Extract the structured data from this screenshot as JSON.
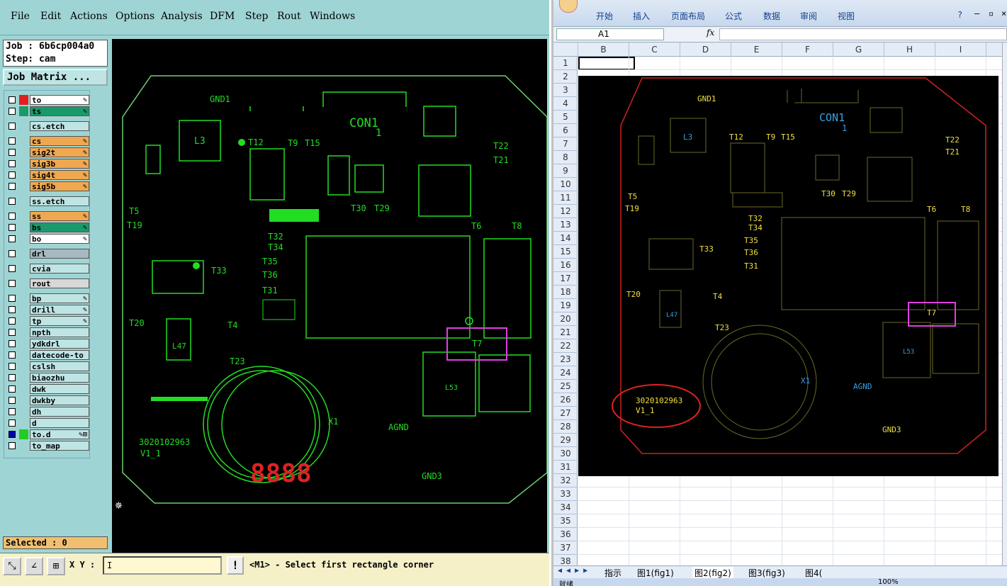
{
  "cam": {
    "menu": [
      "File",
      "Edit",
      "Actions",
      "Options",
      "Analysis",
      "DFM",
      "Step",
      "Rout",
      "Windows"
    ],
    "job_line": "Job : 6b6cp004a0",
    "step_line": "Step: cam",
    "job_matrix": "Job Matrix ...",
    "layers": [
      {
        "name": "to",
        "color": "#e02020",
        "bg": "#ffffff",
        "mark": "✎"
      },
      {
        "name": "ts",
        "color": "#1a9a6a",
        "bg": "#1a9a6a",
        "mark": "✎"
      },
      {
        "name": "cs.etch",
        "color": "",
        "bg": "#bfe4e4",
        "mark": ""
      },
      {
        "name": "cs",
        "color": "",
        "bg": "#f0a850",
        "mark": "✎"
      },
      {
        "name": "sig2t",
        "color": "",
        "bg": "#f0a850",
        "mark": "✎"
      },
      {
        "name": "sig3b",
        "color": "",
        "bg": "#f0a850",
        "mark": "✎"
      },
      {
        "name": "sig4t",
        "color": "",
        "bg": "#f0a850",
        "mark": "✎"
      },
      {
        "name": "sig5b",
        "color": "",
        "bg": "#f0a850",
        "mark": "✎"
      },
      {
        "name": "ss.etch",
        "color": "",
        "bg": "#bfe4e4",
        "mark": ""
      },
      {
        "name": "ss",
        "color": "",
        "bg": "#f0a850",
        "mark": "✎"
      },
      {
        "name": "bs",
        "color": "",
        "bg": "#1a9a6a",
        "mark": "✎"
      },
      {
        "name": "bo",
        "color": "",
        "bg": "#ffffff",
        "mark": "✎"
      },
      {
        "name": "drl",
        "color": "",
        "bg": "#a8b8c0",
        "mark": ""
      },
      {
        "name": "cvia",
        "color": "",
        "bg": "#bfe4e4",
        "mark": ""
      },
      {
        "name": "rout",
        "color": "",
        "bg": "#d8d8d8",
        "mark": ""
      },
      {
        "name": "bp",
        "color": "",
        "bg": "#bfe4e4",
        "mark": "✎"
      },
      {
        "name": "drill",
        "color": "",
        "bg": "#bfe4e4",
        "mark": "✎"
      },
      {
        "name": "tp",
        "color": "",
        "bg": "#bfe4e4",
        "mark": "✎"
      },
      {
        "name": "npth",
        "color": "",
        "bg": "#bfe4e4",
        "mark": ""
      },
      {
        "name": "ydkdrl",
        "color": "",
        "bg": "#bfe4e4",
        "mark": ""
      },
      {
        "name": "datecode-to",
        "color": "",
        "bg": "#bfe4e4",
        "mark": ""
      },
      {
        "name": "cslsh",
        "color": "",
        "bg": "#bfe4e4",
        "mark": ""
      },
      {
        "name": "biaozhu",
        "color": "",
        "bg": "#bfe4e4",
        "mark": ""
      },
      {
        "name": "dwk",
        "color": "",
        "bg": "#bfe4e4",
        "mark": ""
      },
      {
        "name": "dwkby",
        "color": "",
        "bg": "#bfe4e4",
        "mark": ""
      },
      {
        "name": "dh",
        "color": "",
        "bg": "#bfe4e4",
        "mark": ""
      },
      {
        "name": "d",
        "color": "",
        "bg": "#bfe4e4",
        "mark": ""
      },
      {
        "name": "to.d",
        "color": "#22cc22",
        "bg": "#bfe4e4",
        "mark": "✎⊞"
      },
      {
        "name": "to_map",
        "color": "",
        "bg": "#bfe4e4",
        "mark": ""
      }
    ],
    "selected": "Selected : 0",
    "xy_label": "X Y :",
    "xy_value": "I",
    "bang": "!",
    "prompt": "<M1> - Select first rectangle corner",
    "pcb_labels": [
      "GND1",
      "CON1",
      "1",
      "L3",
      "T12",
      "T9",
      "T15",
      "T22",
      "T21",
      "T5",
      "T19",
      "T30",
      "T29",
      "T6",
      "T8",
      "T32",
      "T34",
      "T35",
      "T36",
      "T31",
      "T33",
      "T20",
      "T4",
      "L47",
      "T7",
      "T23",
      "X1",
      "AGND",
      "L53",
      "GND3",
      "3020102963",
      "V1_1",
      "8888"
    ]
  },
  "excel": {
    "tabs": [
      "开始",
      "插入",
      "页面布局",
      "公式",
      "数据",
      "审阅",
      "视图"
    ],
    "name_box": "A1",
    "fx": "fx",
    "columns": [
      "B",
      "C",
      "D",
      "E",
      "F",
      "G",
      "H",
      "I"
    ],
    "rows": [
      "1",
      "2",
      "3",
      "4",
      "5",
      "6",
      "7",
      "8",
      "9",
      "10",
      "11",
      "12",
      "13",
      "14",
      "15",
      "16",
      "17",
      "18",
      "19",
      "20",
      "21",
      "22",
      "23",
      "24",
      "25",
      "26",
      "27",
      "28",
      "29",
      "30",
      "31",
      "32",
      "33",
      "34",
      "35",
      "36",
      "37",
      "38"
    ],
    "sheets": [
      "指示",
      "图1(fig1)",
      "图2(fig2)",
      "图3(fig3)",
      "图4("
    ],
    "status": "就绪",
    "zoom": "100%",
    "pcb_labels": [
      "GND1",
      "CON1",
      "1",
      "L3",
      "T12",
      "T9",
      "T15",
      "T22",
      "T21",
      "T5",
      "T19",
      "T30",
      "T29",
      "T6",
      "T8",
      "T32",
      "T34",
      "T35",
      "T36",
      "T31",
      "T33",
      "T20",
      "T4",
      "L47",
      "T7",
      "T23",
      "X1",
      "AGND",
      "L53",
      "GND3",
      "3020102963",
      "V1_1"
    ]
  }
}
